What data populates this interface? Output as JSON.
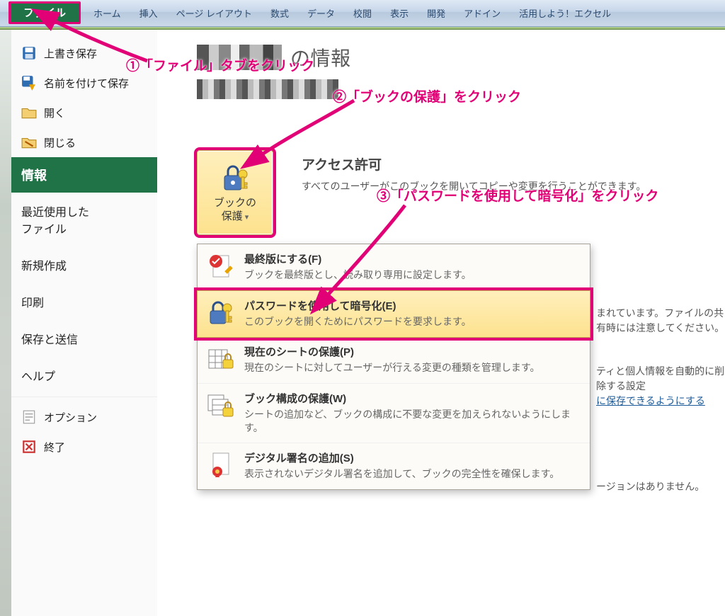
{
  "ribbon": {
    "file_tab": "ファイル",
    "tabs": [
      "ホーム",
      "挿入",
      "ページ レイアウト",
      "数式",
      "データ",
      "校閲",
      "表示",
      "開発",
      "アドイン",
      "活用しよう！エクセル"
    ]
  },
  "backstage_left": {
    "save": "上書き保存",
    "save_as": "名前を付けて保存",
    "open": "開く",
    "close": "閉じる",
    "info": "情報",
    "recent": "最近使用した\nファイル",
    "new": "新規作成",
    "print": "印刷",
    "save_send": "保存と送信",
    "help": "ヘルプ",
    "options": "オプション",
    "exit": "終了"
  },
  "page": {
    "title_suffix": "の情報"
  },
  "protect_button": {
    "label": "ブックの\n保護"
  },
  "permission": {
    "title": "アクセス許可",
    "desc": "すべてのユーザーがこのブックを開いてコピーや変更を行うことができます。"
  },
  "dropdown": {
    "items": [
      {
        "title": "最終版にする(F)",
        "desc": "ブックを最終版とし、読み取り専用に設定します。"
      },
      {
        "title": "パスワードを使用して暗号化(E)",
        "desc": "このブックを開くためにパスワードを要求します。"
      },
      {
        "title": "現在のシートの保護(P)",
        "desc": "現在のシートに対してユーザーが行える変更の種類を管理します。"
      },
      {
        "title": "ブック構成の保護(W)",
        "desc": "シートの追加など、ブックの構成に不要な変更を加えられないようにします。"
      },
      {
        "title": "デジタル署名の追加(S)",
        "desc": "表示されないデジタル署名を追加して、ブックの完全性を確保します。"
      }
    ]
  },
  "side_info": {
    "line1": "まれています。ファイルの共有時には注意してください。",
    "line2a": "ティと個人情報を自動的に削除する設定",
    "line2b_link": "に保存できるようにする",
    "line3": "ージョンはありません。"
  },
  "annotations": {
    "a1": "①「ファイル」タブをクリック",
    "a2": "②「ブックの保護」をクリック",
    "a3": "③「パスワードを使用して暗号化」をクリック"
  }
}
